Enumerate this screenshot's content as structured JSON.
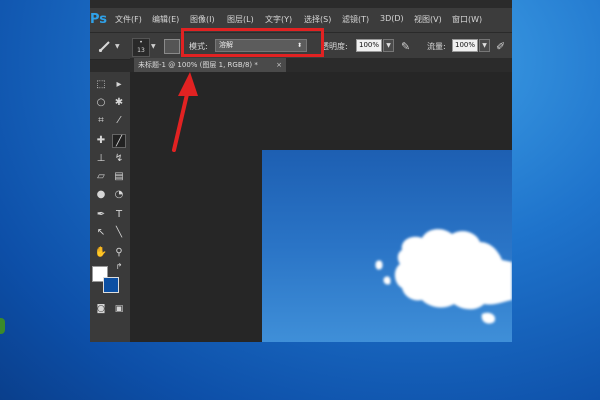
{
  "app": {
    "logo": "Ps"
  },
  "menu": {
    "items": [
      "文件(F)",
      "编辑(E)",
      "图像(I)",
      "图层(L)",
      "文字(Y)",
      "选择(S)",
      "滤镜(T)",
      "3D(D)",
      "视图(V)",
      "窗口(W)"
    ]
  },
  "options": {
    "brush_size": "13",
    "mode_label": "模式:",
    "mode_value": "溶解",
    "opacity_label": "透明度:",
    "opacity_value": "100%",
    "flow_label": "流量:",
    "flow_value": "100%"
  },
  "document": {
    "tab_title": "未标题-1 @ 100% (图层 1, RGB/8) *",
    "close_glyph": "×"
  },
  "tools": [
    {
      "name": "marquee-tool-icon",
      "glyph": "⬚"
    },
    {
      "name": "move-tool-icon",
      "glyph": "▸"
    },
    {
      "name": "lasso-tool-icon",
      "glyph": "○"
    },
    {
      "name": "magic-wand-tool-icon",
      "glyph": "✱"
    },
    {
      "name": "crop-tool-icon",
      "glyph": "⌗"
    },
    {
      "name": "eyedropper-tool-icon",
      "glyph": "⁄"
    },
    {
      "name": "healing-brush-tool-icon",
      "glyph": "✚"
    },
    {
      "name": "brush-tool-icon",
      "glyph": "╱"
    },
    {
      "name": "clone-stamp-tool-icon",
      "glyph": "⊥"
    },
    {
      "name": "history-brush-tool-icon",
      "glyph": "↯"
    },
    {
      "name": "eraser-tool-icon",
      "glyph": "▱"
    },
    {
      "name": "gradient-tool-icon",
      "glyph": "▤"
    },
    {
      "name": "blur-tool-icon",
      "glyph": "●"
    },
    {
      "name": "dodge-tool-icon",
      "glyph": "◔"
    },
    {
      "name": "pen-tool-icon",
      "glyph": "✒"
    },
    {
      "name": "type-tool-icon",
      "glyph": "T"
    },
    {
      "name": "path-selection-tool-icon",
      "glyph": "↖"
    },
    {
      "name": "line-tool-icon",
      "glyph": "╲"
    },
    {
      "name": "hand-tool-icon",
      "glyph": "✋"
    },
    {
      "name": "zoom-tool-icon",
      "glyph": "⚲"
    }
  ],
  "colors": {
    "foreground": "#ffffff",
    "background": "#0b4fa3",
    "highlight": "#e12222"
  }
}
